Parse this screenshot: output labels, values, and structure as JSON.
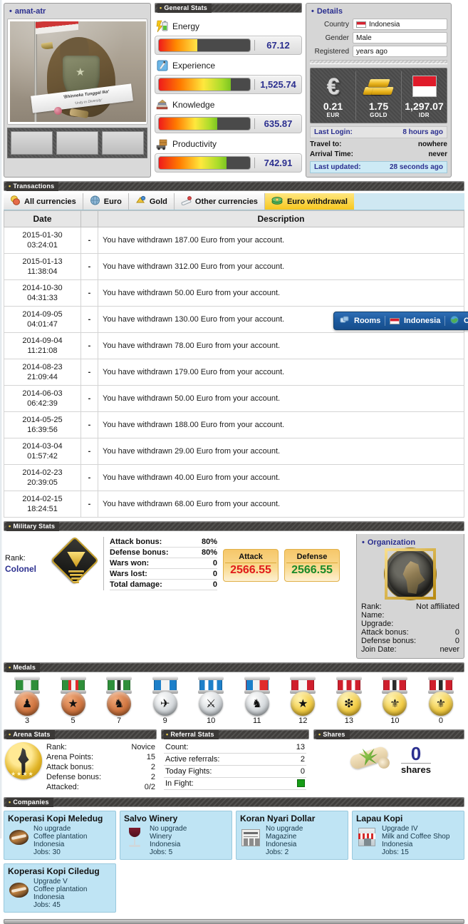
{
  "profile": {
    "username": "amat-atr",
    "avatar_caption_main": "'Bhinneka Tunggal Ika'",
    "avatar_caption_sub": "'Unity in Diversity'"
  },
  "general_stats": {
    "title": "General Stats",
    "items": [
      {
        "icon": "energy-icon",
        "label": "Energy",
        "value": "67.12",
        "percent": 42
      },
      {
        "icon": "experience-icon",
        "label": "Experience",
        "value": "1,525.74",
        "percent": 79
      },
      {
        "icon": "knowledge-icon",
        "label": "Knowledge",
        "value": "635.87",
        "percent": 64
      },
      {
        "icon": "productivity-icon",
        "label": "Productivity",
        "value": "742.91",
        "percent": 74
      }
    ]
  },
  "details": {
    "title": "Details",
    "country_label": "Country",
    "country_value": "Indonesia",
    "gender_label": "Gender",
    "gender_value": "Male",
    "registered_label": "Registered",
    "registered_value": "years ago",
    "wallets": [
      {
        "amount": "0.21",
        "currency": "EUR",
        "icon": "euro-icon"
      },
      {
        "amount": "1.75",
        "currency": "GOLD",
        "icon": "gold-bars-icon"
      },
      {
        "amount": "1,297.07",
        "currency": "IDR",
        "icon": "indonesia-flag-icon"
      }
    ],
    "last_login_label": "Last Login:",
    "last_login_value": "8 hours ago",
    "travel_label": "Travel to:",
    "travel_value": "nowhere",
    "arrival_label": "Arrival Time:",
    "arrival_value": "never",
    "last_updated_label": "Last updated:",
    "last_updated_value": "28 seconds ago"
  },
  "transactions": {
    "title": "Transactions",
    "tabs": [
      {
        "label": "All currencies",
        "icon": "coins-icon",
        "active": false
      },
      {
        "label": "Euro",
        "icon": "globe-icon",
        "active": false
      },
      {
        "label": "Gold",
        "icon": "gold-icon",
        "active": false
      },
      {
        "label": "Other currencies",
        "icon": "banknote-icon",
        "active": false
      },
      {
        "label": "Euro withdrawal",
        "icon": "money-stack-icon",
        "active": true
      }
    ],
    "columns": {
      "date": "Date",
      "sign": "",
      "description": "Description"
    },
    "rows": [
      {
        "date": "2015-01-30",
        "time": "03:24:01",
        "sign": "-",
        "description": "You have withdrawn 187.00 Euro from your account."
      },
      {
        "date": "2015-01-13",
        "time": "11:38:04",
        "sign": "-",
        "description": "You have withdrawn 312.00 Euro from your account."
      },
      {
        "date": "2014-10-30",
        "time": "04:31:33",
        "sign": "-",
        "description": "You have withdrawn 50.00 Euro from your account."
      },
      {
        "date": "2014-09-05",
        "time": "04:01:47",
        "sign": "-",
        "description": "You have withdrawn 130.00 Euro from your account."
      },
      {
        "date": "2014-09-04",
        "time": "11:21:08",
        "sign": "-",
        "description": "You have withdrawn 78.00 Euro from your account."
      },
      {
        "date": "2014-08-23",
        "time": "21:09:44",
        "sign": "-",
        "description": "You have withdrawn 179.00 Euro from your account."
      },
      {
        "date": "2014-06-03",
        "time": "06:42:39",
        "sign": "-",
        "description": "You have withdrawn 50.00 Euro from your account."
      },
      {
        "date": "2014-05-25",
        "time": "16:39:56",
        "sign": "-",
        "description": "You have withdrawn 188.00 Euro from your account."
      },
      {
        "date": "2014-03-04",
        "time": "01:57:42",
        "sign": "-",
        "description": "You have withdrawn 29.00 Euro from your account."
      },
      {
        "date": "2014-02-23",
        "time": "20:39:05",
        "sign": "-",
        "description": "You have withdrawn 40.00 Euro from your account."
      },
      {
        "date": "2014-02-15",
        "time": "18:24:51",
        "sign": "-",
        "description": "You have withdrawn 68.00 Euro from your account."
      }
    ]
  },
  "overlay": {
    "rooms_label": "Rooms",
    "country_label": "Indonesia",
    "third_label": "C"
  },
  "military": {
    "title": "Military Stats",
    "rank_label": "Rank:",
    "rank_value": "Colonel",
    "stats": [
      {
        "label": "Attack bonus:",
        "value": "80%"
      },
      {
        "label": "Defense bonus:",
        "value": "80%"
      },
      {
        "label": "Wars won:",
        "value": "0"
      },
      {
        "label": "Wars lost:",
        "value": "0"
      },
      {
        "label": "Total damage:",
        "value": "0"
      }
    ],
    "attack_label": "Attack",
    "attack_value": "2566.55",
    "defense_label": "Defense",
    "defense_value": "2566.55"
  },
  "organization": {
    "title": "Organization",
    "rows": [
      {
        "label": "Rank:",
        "value": "Not affiliated"
      },
      {
        "label": "Name:",
        "value": ""
      },
      {
        "label": "Upgrade:",
        "value": ""
      },
      {
        "label": "Attack bonus:",
        "value": "0"
      },
      {
        "label": "Defense bonus:",
        "value": "0"
      },
      {
        "label": "Join Date:",
        "value": "never"
      }
    ]
  },
  "medals": {
    "title": "Medals",
    "items": [
      {
        "tier": "bronze",
        "ribbon": "rib-green",
        "glyph": "♟",
        "count": "3"
      },
      {
        "tier": "bronze",
        "ribbon": "rib-greenred",
        "glyph": "★",
        "count": "5"
      },
      {
        "tier": "bronze",
        "ribbon": "rib-greenbw",
        "glyph": "♞",
        "count": "7"
      },
      {
        "tier": "silver",
        "ribbon": "rib-blue",
        "glyph": "✈",
        "count": "9"
      },
      {
        "tier": "silver",
        "ribbon": "rib-blue3",
        "glyph": "⚔",
        "count": "10"
      },
      {
        "tier": "silver",
        "ribbon": "rib-bluered",
        "glyph": "♞",
        "count": "11"
      },
      {
        "tier": "gold",
        "ribbon": "rib-red",
        "glyph": "★",
        "count": "12"
      },
      {
        "tier": "gold",
        "ribbon": "rib-red3",
        "glyph": "❇",
        "count": "13"
      },
      {
        "tier": "gold",
        "ribbon": "rib-redbw",
        "glyph": "⚜",
        "count": "10"
      },
      {
        "tier": "gold",
        "ribbon": "rib-redbw",
        "glyph": "⚜",
        "count": "0"
      }
    ]
  },
  "arena": {
    "title": "Arena Stats",
    "rows": [
      {
        "label": "Rank:",
        "value": "Novice"
      },
      {
        "label": "Arena Points:",
        "value": "15"
      },
      {
        "label": "Attack bonus:",
        "value": "2"
      },
      {
        "label": "Defense bonus:",
        "value": "2"
      },
      {
        "label": "Attacked:",
        "value": "0/2"
      }
    ]
  },
  "referral": {
    "title": "Referral Stats",
    "rows": [
      {
        "label": "Count:",
        "value": "13",
        "type": "text"
      },
      {
        "label": "Active referrals:",
        "value": "2",
        "type": "text"
      },
      {
        "label": "Today Fights:",
        "value": "0",
        "type": "text"
      },
      {
        "label": "In Fight:",
        "value": "",
        "type": "indicator"
      }
    ]
  },
  "shares": {
    "title": "Shares",
    "count": "0",
    "label": "shares"
  },
  "companies": {
    "title": "Companies",
    "items": [
      {
        "name": "Koperasi Kopi Meledug",
        "icon": "coffee-bean-icon",
        "upgrade": "No upgrade",
        "type": "Coffee plantation",
        "country": "Indonesia",
        "jobs": "Jobs: 30"
      },
      {
        "name": "Salvo Winery",
        "icon": "wine-glass-icon",
        "upgrade": "No upgrade",
        "type": "Winery",
        "country": "Indonesia",
        "jobs": "Jobs: 5"
      },
      {
        "name": "Koran Nyari Dollar",
        "icon": "newspaper-icon",
        "upgrade": "No upgrade",
        "type": "Magazine",
        "country": "Indonesia",
        "jobs": "Jobs: 2"
      },
      {
        "name": "Lapau Kopi",
        "icon": "shop-icon",
        "upgrade": "Upgrade IV",
        "type": "Milk and Coffee Shop",
        "country": "Indonesia",
        "jobs": "Jobs: 15"
      },
      {
        "name": "Koperasi Kopi Ciledug",
        "icon": "coffee-bean-icon",
        "upgrade": "Upgrade V",
        "type": "Coffee plantation",
        "country": "Indonesia",
        "jobs": "Jobs: 45"
      }
    ]
  },
  "colors": {
    "accent_blue": "#2b2f8f",
    "attack_red": "#e01b1b",
    "defense_green": "#1a8a2a",
    "tab_active": "#f7c71f",
    "company_bg": "#bfe4f4"
  }
}
